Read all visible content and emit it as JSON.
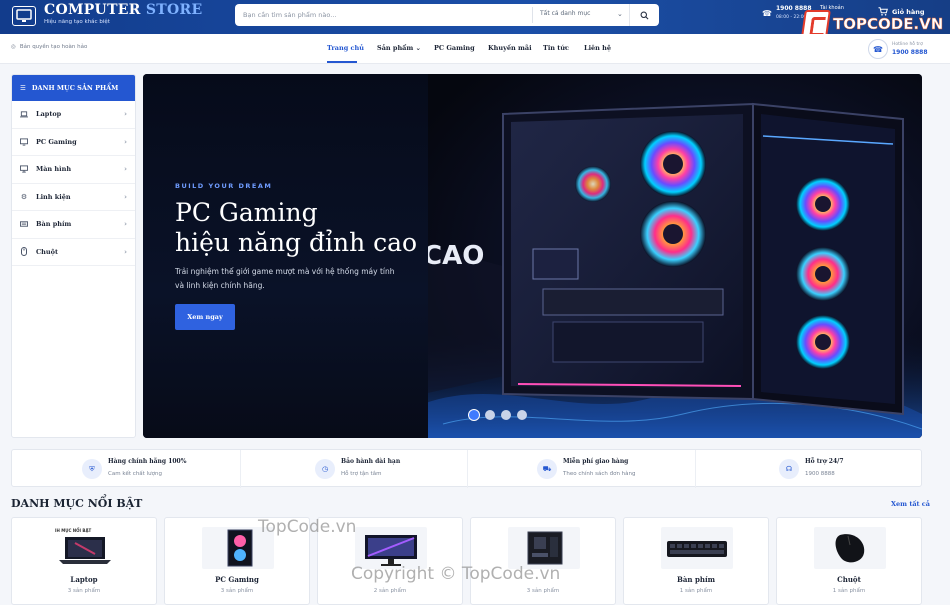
{
  "header": {
    "brand_main": "COMPUTER",
    "brand_accent": "STORE",
    "slogan": "Hiệu năng tạo khác biệt",
    "search": {
      "placeholder": "Bạn cần tìm sản phẩm nào...",
      "category": "Tất cả danh mục"
    },
    "hotline": {
      "number": "1900 8888",
      "hours": "08:00 - 22:00"
    },
    "account_label": "Tài khoản",
    "cart_label": "Giỏ hàng"
  },
  "overlay_logo": {
    "text": "TOPCODE.VN"
  },
  "nav": {
    "copyright": "Bản quyền tạo hoàn hảo",
    "items": [
      {
        "label": "Trang chủ"
      },
      {
        "label": "Sản phẩm"
      },
      {
        "label": "PC Gaming"
      },
      {
        "label": "Khuyến mãi"
      },
      {
        "label": "Tin tức"
      },
      {
        "label": "Liên hệ"
      }
    ],
    "hotline_label": "Hotline hỗ trợ",
    "hotline_number": "1900 8888"
  },
  "sidebar": {
    "title": "DANH MỤC SẢN PHẨM",
    "items": [
      {
        "label": "Laptop",
        "icon": "laptop-icon"
      },
      {
        "label": "PC Gaming",
        "icon": "pc-icon"
      },
      {
        "label": "Màn hình",
        "icon": "monitor-icon"
      },
      {
        "label": "Linh kiện",
        "icon": "component-icon"
      },
      {
        "label": "Bàn phím",
        "icon": "keyboard-icon"
      },
      {
        "label": "Chuột",
        "icon": "mouse-icon"
      }
    ]
  },
  "hero": {
    "kicker": "BUILD YOUR DREAM",
    "title_line1": "PC Gaming",
    "title_line2": "hiệu năng đỉnh cao",
    "description": "Trải nghiệm thế giới game mượt mà với hệ thống máy tính và linh kiện chính hãng.",
    "cta": "Xem ngay",
    "banner_text": "CAO",
    "slides_total": 4,
    "active_slide": 1
  },
  "features": [
    {
      "title": "Hàng chính hãng 100%",
      "subtitle": "Cam kết chất lượng",
      "icon": "shield-icon"
    },
    {
      "title": "Bảo hành dài hạn",
      "subtitle": "Hỗ trợ tận tâm",
      "icon": "clock-icon"
    },
    {
      "title": "Miễn phí giao hàng",
      "subtitle": "Theo chính sách đơn hàng",
      "icon": "truck-icon"
    },
    {
      "title": "Hỗ trợ 24/7",
      "subtitle": "1900 8888",
      "icon": "headset-icon"
    }
  ],
  "featured": {
    "title": "DANH MỤC NỔI BẬT",
    "view_all": "Xem tất cả",
    "categories": [
      {
        "name": "Laptop",
        "count": "3 sản phẩm",
        "tag": "IH MỤC NỔI BẬT"
      },
      {
        "name": "PC Gaming",
        "count": "3 sản phẩm"
      },
      {
        "name": "",
        "count": "2 sản phẩm"
      },
      {
        "name": "",
        "count": "3 sản phẩm"
      },
      {
        "name": "Bàn phím",
        "count": "1 sản phẩm"
      },
      {
        "name": "Chuột",
        "count": "1 sản phẩm"
      }
    ]
  },
  "watermarks": {
    "line1": "TopCode.vn",
    "line2": "Copyright © TopCode.vn"
  },
  "colors": {
    "primary": "#2457d1",
    "header": "#1b4fa8",
    "hero_bg": "#070b18"
  }
}
